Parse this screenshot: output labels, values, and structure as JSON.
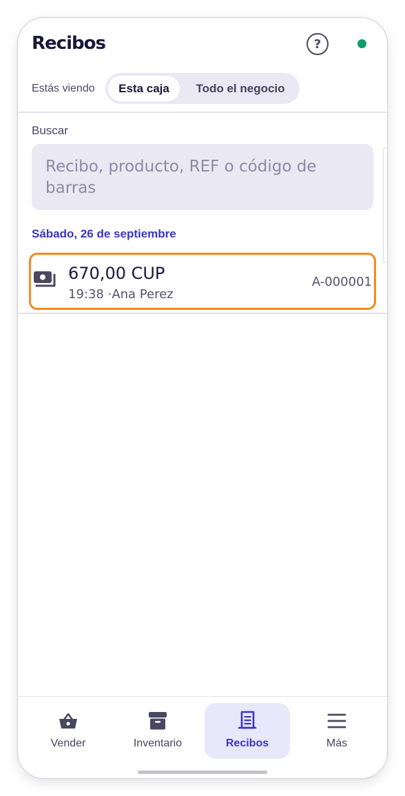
{
  "header": {
    "title": "Recibos",
    "help_icon": "help-circle-icon",
    "status_icon": "online-status-dot",
    "status_color": "#0f9d6b"
  },
  "view_toggle": {
    "label": "Estás viendo",
    "options": [
      "Esta caja",
      "Todo el negocio"
    ],
    "selected": "Esta caja"
  },
  "search": {
    "label": "Buscar",
    "placeholder": "Recibo, producto, REF o código de barras",
    "value": ""
  },
  "receipts": {
    "groups": [
      {
        "date": "Sábado, 26 de septiembre",
        "items": [
          {
            "icon": "cash-icon",
            "amount": "670,00 CUP",
            "time": "19:38",
            "cashier": "·Ana Perez",
            "id": "A-000001",
            "highlight_color": "#f28a1d"
          }
        ]
      }
    ]
  },
  "bottom_nav": {
    "items": [
      {
        "label": "Vender",
        "icon": "basket-icon"
      },
      {
        "label": "Inventario",
        "icon": "archive-box-icon"
      },
      {
        "label": "Recibos",
        "icon": "receipt-icon",
        "active": true
      },
      {
        "label": "Más",
        "icon": "menu-icon"
      }
    ],
    "accent_color": "#3a35c4"
  }
}
